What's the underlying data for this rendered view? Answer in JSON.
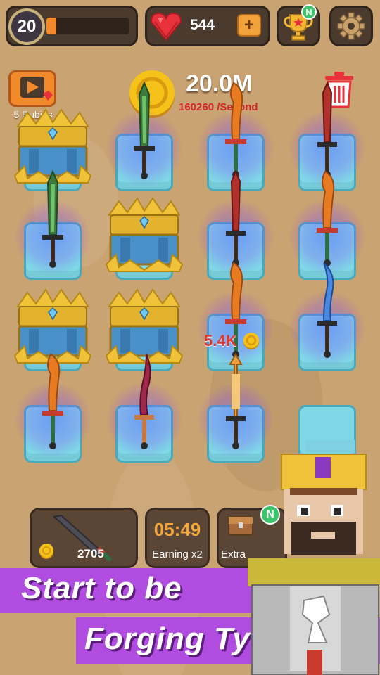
{
  "player": {
    "level": "20",
    "xp_progress": 0.12
  },
  "rubies": {
    "count": "544",
    "add": "+"
  },
  "video_reward": {
    "label": "5 Rubies"
  },
  "gold": {
    "amount": "20.0M",
    "rate": "160260 /Second"
  },
  "floating_earning": "5.4K",
  "shop": {
    "price": "2705"
  },
  "boost": {
    "timer": "05:49",
    "label": "Earning x2"
  },
  "extra": {
    "label": "Extra",
    "badge": "N"
  },
  "trophy_badge": "N",
  "slogan": {
    "line1": "Start to be",
    "line2": "Forging Tycoon"
  },
  "grid": [
    [
      "chest",
      "green-sword",
      "orange-blade",
      "red-sword"
    ],
    [
      "green-sword",
      "chest",
      "red-sword",
      "orange-blade"
    ],
    [
      "chest",
      "chest",
      "orange-blade",
      "blue-blade"
    ],
    [
      "orange-blade",
      "crimson-blade",
      "gold-spear",
      "empty"
    ]
  ],
  "colors": {
    "ruby": "#e8313a",
    "accent": "#f28a2b",
    "banner": "#b04ce0",
    "pedestal": "#7fd8e6",
    "earning": "#e0382e"
  }
}
